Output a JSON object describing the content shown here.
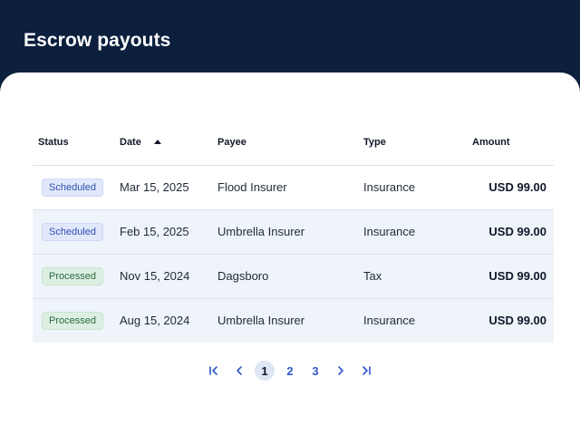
{
  "header": {
    "title": "Escrow payouts"
  },
  "table": {
    "columns": {
      "status": "Status",
      "date": "Date",
      "payee": "Payee",
      "type": "Type",
      "amount": "Amount"
    },
    "sort": {
      "column": "Date",
      "direction": "ascending"
    },
    "rows": [
      {
        "status": "Scheduled",
        "date": "Mar 15, 2025",
        "payee": "Flood Insurer",
        "type": "Insurance",
        "amount": "USD 99.00"
      },
      {
        "status": "Scheduled",
        "date": "Feb 15, 2025",
        "payee": "Umbrella Insurer",
        "type": "Insurance",
        "amount": "USD 99.00"
      },
      {
        "status": "Processed",
        "date": "Nov 15, 2024",
        "payee": "Dagsboro",
        "type": "Tax",
        "amount": "USD 99.00"
      },
      {
        "status": "Processed",
        "date": "Aug 15, 2024",
        "payee": "Umbrella Insurer",
        "type": "Insurance",
        "amount": "USD 99.00"
      }
    ]
  },
  "pagination": {
    "pages": [
      "1",
      "2",
      "3"
    ],
    "current_page": "1"
  },
  "colors": {
    "header_bg": "#0c1f3d",
    "scheduled_badge": "#e1e8fb",
    "processed_badge": "#dcefe2",
    "link": "#2f56c8"
  }
}
